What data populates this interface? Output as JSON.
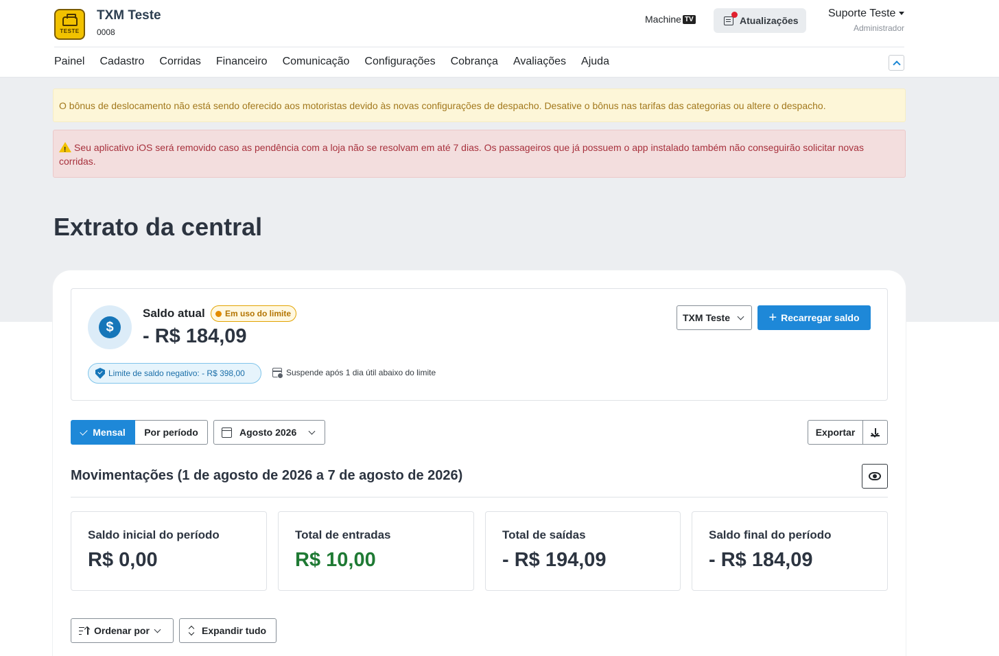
{
  "header": {
    "brand_name": "TXM Teste",
    "brand_code": "0008",
    "logo_text": "TESTE",
    "machinetv_label": "Machine",
    "machinetv_badge": "TV",
    "updates_label": "Atualizações",
    "user_name": "Suporte Teste",
    "user_role": "Administrador"
  },
  "nav": {
    "items": [
      "Painel",
      "Cadastro",
      "Corridas",
      "Financeiro",
      "Comunicação",
      "Configurações",
      "Cobrança",
      "Avaliações",
      "Ajuda"
    ]
  },
  "alerts": {
    "warning": "O bônus de deslocamento não está sendo oferecido aos motoristas devido às novas configurações de despacho. Desative o bônus nas tarifas das categorias ou altere o despacho.",
    "danger": "Seu aplicativo iOS será removido caso as pendência com a loja não se resolvam em até 7 dias. Os passageiros que já possuem o app instalado também não conseguirão solicitar novas corridas."
  },
  "page": {
    "title": "Extrato da central"
  },
  "balance": {
    "label": "Saldo atual",
    "badge": "Em uso do limite",
    "value": "- R$ 184,09",
    "negative_limit": "Limite de saldo negativo: - R$ 398,00",
    "suspend_note": "Suspende após 1 dia útil abaixo do limite",
    "account_select": "TXM Teste",
    "recharge_label": "Recarregar saldo"
  },
  "filters": {
    "monthly_label": "Mensal",
    "period_label": "Por período",
    "month_value": "Agosto 2026",
    "export_label": "Exportar"
  },
  "movements": {
    "title": "Movimentações (1 de agosto de 2026 a 7 de agosto de 2026)",
    "stats": [
      {
        "label": "Saldo inicial do período",
        "value": "R$ 0,00"
      },
      {
        "label": "Total de entradas",
        "value": "R$ 10,00"
      },
      {
        "label": "Total de saídas",
        "value": "- R$ 194,09"
      },
      {
        "label": "Saldo final do período",
        "value": "- R$ 184,09"
      }
    ],
    "sort_label": "Ordenar por",
    "expand_label": "Expandir tudo"
  },
  "colors": {
    "primary": "#1e88d8",
    "positive": "#1f7a34",
    "warning_text": "#a2781c",
    "danger_text": "#a7303c"
  }
}
